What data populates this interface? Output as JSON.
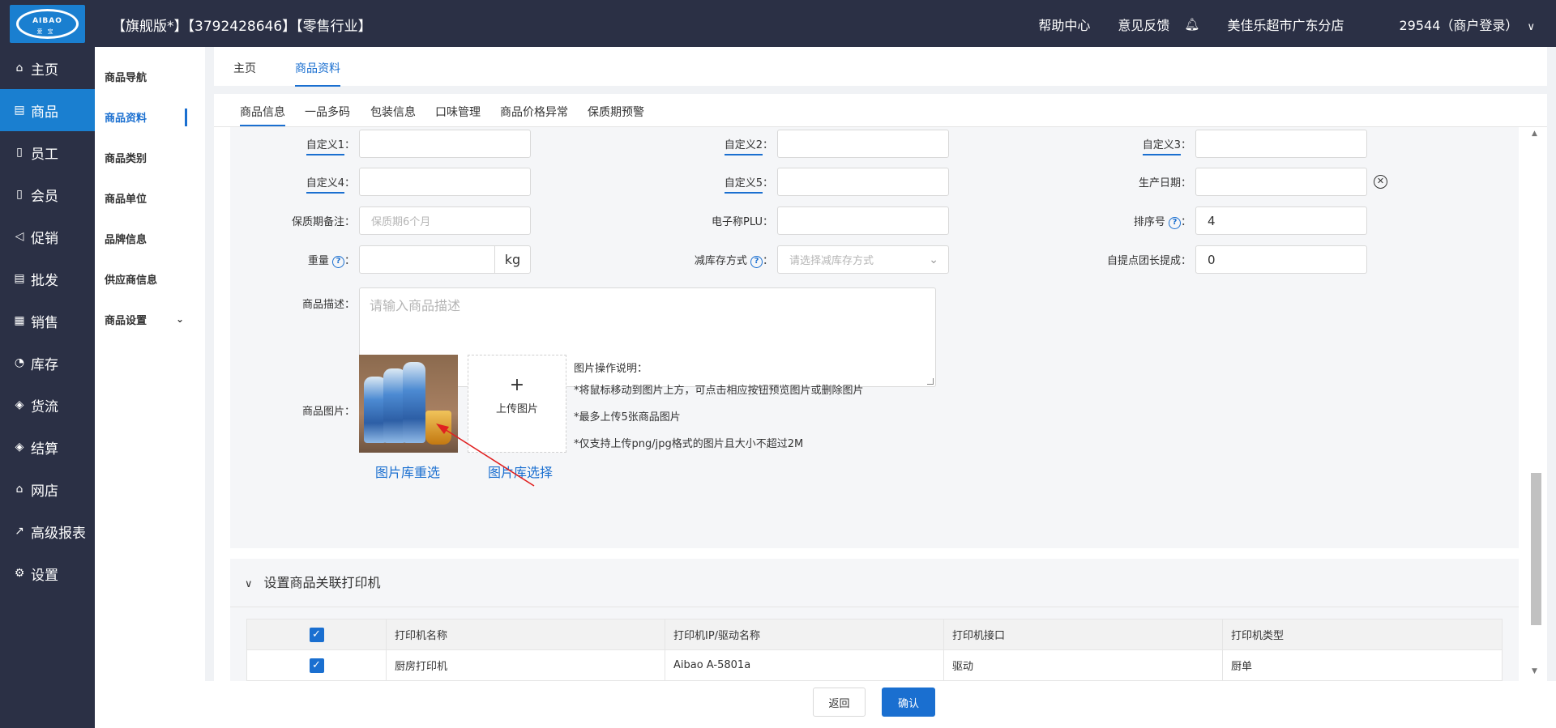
{
  "logo": {
    "line1": "AIBAO",
    "line2": "爱宝"
  },
  "header": {
    "title": "【旗舰版*】【3792428646】【零售行业】",
    "help": "帮助中心",
    "feedback": "意见反馈",
    "store": "美佳乐超市广东分店",
    "account": "29544（商户登录）"
  },
  "sidebar": {
    "items": [
      {
        "icon": "home-icon",
        "glyph": "⌂",
        "label": "主页"
      },
      {
        "icon": "goods-icon",
        "glyph": "▤",
        "label": "商品"
      },
      {
        "icon": "staff-icon",
        "glyph": "▯",
        "label": "员工"
      },
      {
        "icon": "member-icon",
        "glyph": "▯",
        "label": "会员"
      },
      {
        "icon": "promo-icon",
        "glyph": "◁",
        "label": "促销"
      },
      {
        "icon": "wholesale-icon",
        "glyph": "▤",
        "label": "批发"
      },
      {
        "icon": "sales-icon",
        "glyph": "▦",
        "label": "销售"
      },
      {
        "icon": "stock-icon",
        "glyph": "◔",
        "label": "库存"
      },
      {
        "icon": "logistics-icon",
        "glyph": "◈",
        "label": "货流"
      },
      {
        "icon": "settle-icon",
        "glyph": "◈",
        "label": "结算"
      },
      {
        "icon": "shop-icon",
        "glyph": "⌂",
        "label": "网店"
      },
      {
        "icon": "report-icon",
        "glyph": "↗",
        "label": "高级报表"
      },
      {
        "icon": "settings-icon",
        "glyph": "⚙",
        "label": "设置"
      }
    ]
  },
  "subnav": {
    "items": [
      "商品导航",
      "商品资料",
      "商品类别",
      "商品单位",
      "品牌信息",
      "供应商信息",
      "商品设置"
    ]
  },
  "page_tabs": {
    "home": "主页",
    "goods_info": "商品资料"
  },
  "form_tabs": [
    "商品信息",
    "一品多码",
    "包装信息",
    "口味管理",
    "商品价格异常",
    "保质期预警"
  ],
  "form": {
    "custom1": {
      "label": "自定义1",
      "value": ""
    },
    "custom2": {
      "label": "自定义2",
      "value": ""
    },
    "custom3": {
      "label": "自定义3",
      "value": ""
    },
    "custom4": {
      "label": "自定义4",
      "value": ""
    },
    "custom5": {
      "label": "自定义5",
      "value": ""
    },
    "production_date": {
      "label": "生产日期：",
      "value": ""
    },
    "shelf_note": {
      "label": "保质期备注：",
      "placeholder": "保质期6个月"
    },
    "plu": {
      "label": "电子称PLU：",
      "value": ""
    },
    "sort_no": {
      "label": "排序号",
      "value": "4"
    },
    "weight": {
      "label": "重量",
      "value": "",
      "unit": "kg"
    },
    "stock_reduce": {
      "label": "减库存方式",
      "placeholder": "请选择减库存方式"
    },
    "commission": {
      "label": "自提点团长提成：",
      "value": "0"
    },
    "description": {
      "label": "商品描述：",
      "placeholder": "请输入商品描述"
    },
    "image": {
      "label": "商品图片：",
      "upload": "上传图片",
      "reselect": "图片库重选",
      "library": "图片库选择"
    },
    "notes": [
      "图片操作说明：",
      "*将鼠标移动到图片上方，可点击相应按钮预览图片或删除图片",
      "*最多上传5张商品图片",
      "*仅支持上传png/jpg格式的图片且大小不超过2M"
    ]
  },
  "printer": {
    "title": "设置商品关联打印机",
    "headers": [
      "打印机名称",
      "打印机IP/驱动名称",
      "打印机接口",
      "打印机类型"
    ],
    "rows": [
      {
        "name": "厨房打印机",
        "ip": "Aibao A-5801a",
        "port": "驱动",
        "type": "厨单",
        "checked": true
      }
    ]
  },
  "footer": {
    "back": "返回",
    "confirm": "确认"
  },
  "colors": {
    "accent": "#1a6fd0",
    "sidebar": "#2b3045",
    "arrow": "#e02020"
  }
}
